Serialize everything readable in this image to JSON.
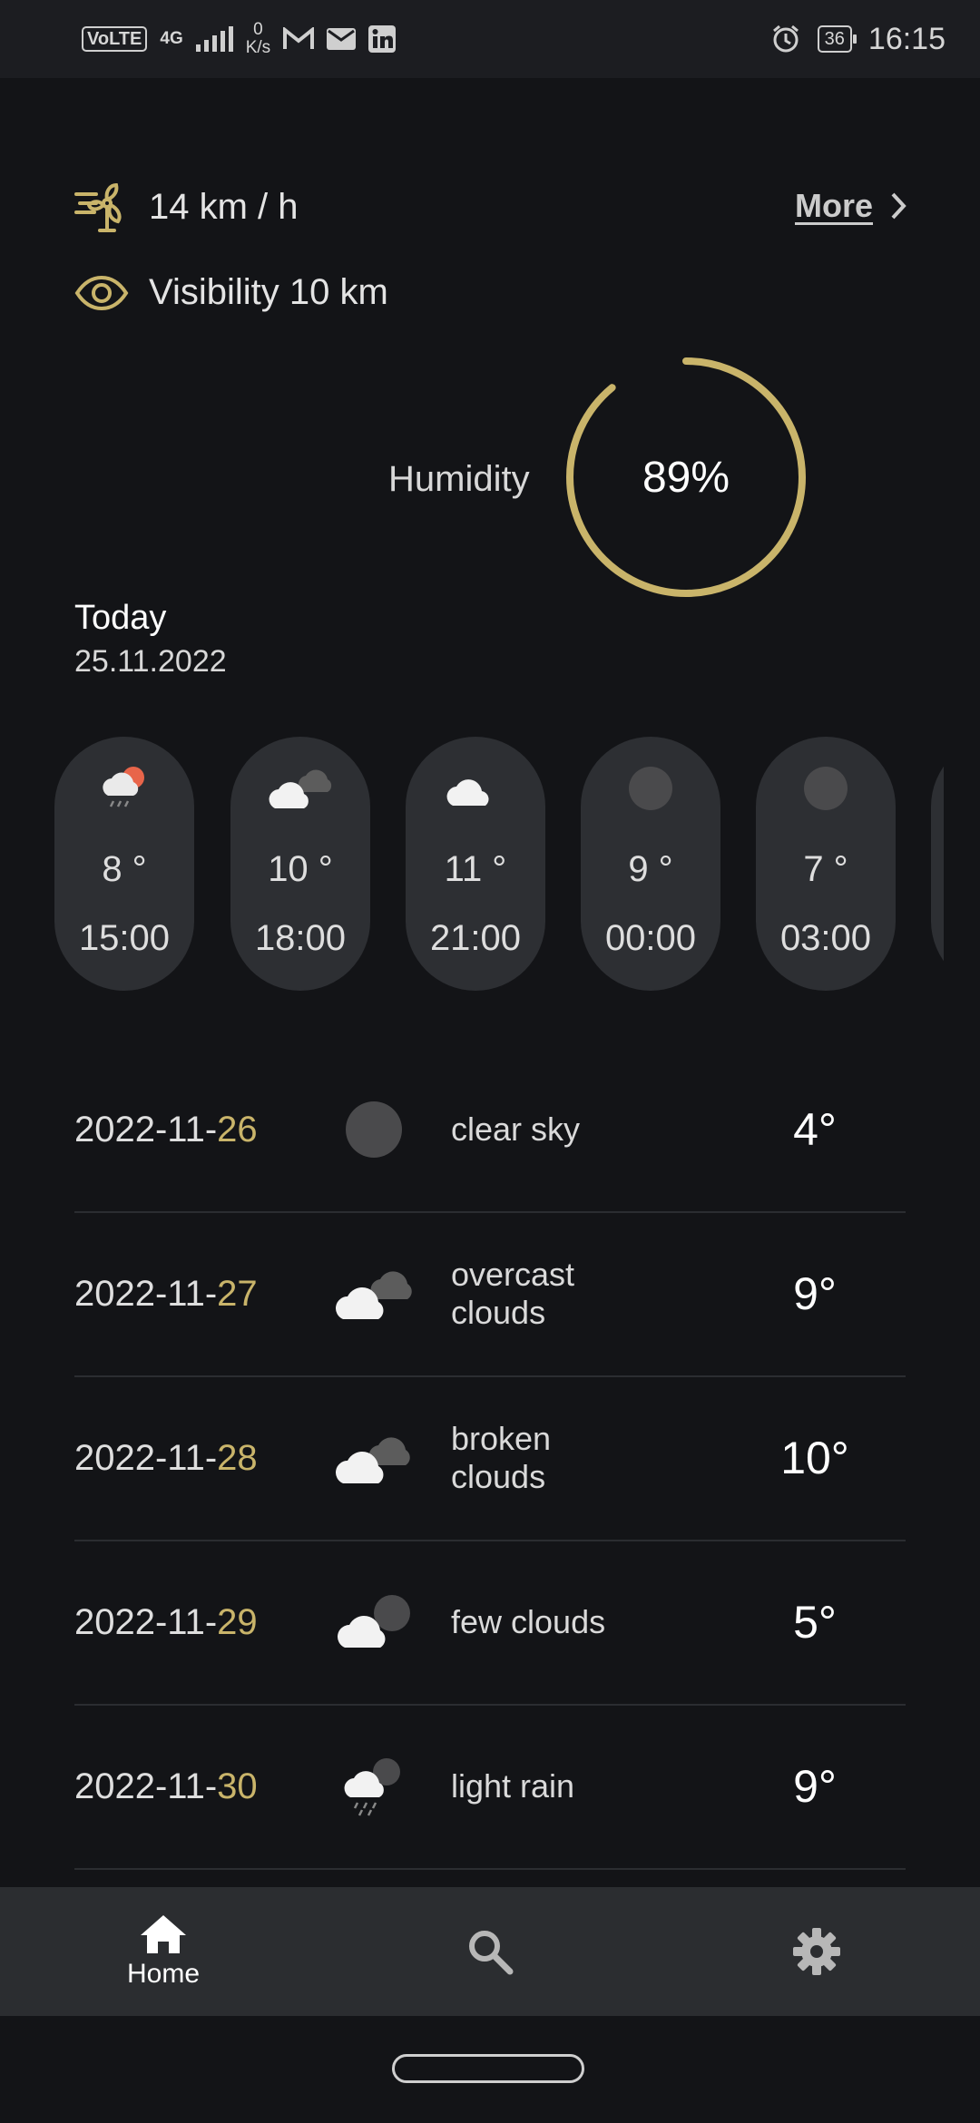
{
  "status_bar": {
    "volte": "VoLTE",
    "network_type": "4G",
    "network_speed_value": "0",
    "network_speed_unit": "K/s",
    "notification_icons": [
      "gmail-icon",
      "mail-icon",
      "linkedin-icon"
    ],
    "alarm_icon": "alarm-icon",
    "battery": "36",
    "time": "16:15"
  },
  "wind": {
    "icon": "wind-turbine-icon",
    "text": "14 km / h"
  },
  "visibility": {
    "icon": "eye-icon",
    "text": "Visibility 10 km"
  },
  "more": {
    "label": "More"
  },
  "humidity": {
    "label": "Humidity",
    "value": "89%",
    "fraction": 0.89
  },
  "today": {
    "label": "Today",
    "date": "25.11.2022"
  },
  "hourly": [
    {
      "icon": "sun-cloud-rain-icon",
      "temp": "8 °",
      "time": "15:00"
    },
    {
      "icon": "overcast-clouds-icon",
      "temp": "10 °",
      "time": "18:00"
    },
    {
      "icon": "cloud-icon",
      "temp": "11 °",
      "time": "21:00"
    },
    {
      "icon": "moon-icon",
      "temp": "9 °",
      "time": "00:00"
    },
    {
      "icon": "moon-icon",
      "temp": "7 °",
      "time": "03:00"
    }
  ],
  "daily": [
    {
      "date_prefix": "2022-11-",
      "day": "26",
      "icon": "moon-icon",
      "desc": "clear sky",
      "temp": "4°"
    },
    {
      "date_prefix": "2022-11-",
      "day": "27",
      "icon": "overcast-clouds-icon",
      "desc": "overcast clouds",
      "temp": "9°"
    },
    {
      "date_prefix": "2022-11-",
      "day": "28",
      "icon": "broken-clouds-icon",
      "desc": "broken clouds",
      "temp": "10°"
    },
    {
      "date_prefix": "2022-11-",
      "day": "29",
      "icon": "few-clouds-icon",
      "desc": "few clouds",
      "temp": "5°"
    },
    {
      "date_prefix": "2022-11-",
      "day": "30",
      "icon": "light-rain-icon",
      "desc": "light rain",
      "temp": "9°"
    }
  ],
  "nav": {
    "home_label": "Home",
    "home_icon": "home-icon",
    "search_icon": "search-icon",
    "settings_icon": "gear-icon"
  },
  "colors": {
    "accent": "#c9b46a",
    "background": "#131417",
    "card": "#2d2f33",
    "nav": "#2b2d30"
  }
}
